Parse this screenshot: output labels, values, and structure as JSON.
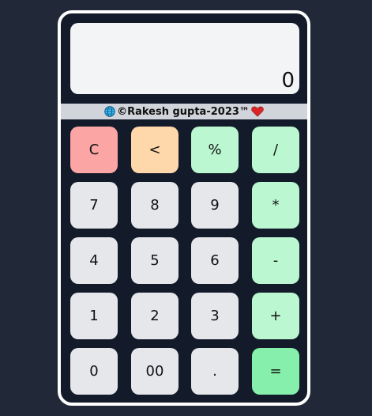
{
  "display": {
    "value": "0"
  },
  "credit": {
    "text": "©Rakesh gupta-2023™",
    "leading_icon": "globe-icon",
    "trailing_icon": "heart-icon"
  },
  "colors": {
    "page_background": "#212938",
    "calculator_body": "#131a29",
    "display_background": "#f3f4f6",
    "credit_bar": "#d1d5db",
    "clear_key": "#fca5a5",
    "backspace_key": "#fed7aa",
    "operator_key": "#bbf7d0",
    "equals_key": "#86efac",
    "number_key": "#e5e7eb",
    "heart": "#dc2626"
  },
  "keys": [
    {
      "label": "C",
      "name": "clear-button",
      "type": "clear"
    },
    {
      "label": "<",
      "name": "backspace-button",
      "type": "backspace"
    },
    {
      "label": "%",
      "name": "percent-button",
      "type": "operator"
    },
    {
      "label": "/",
      "name": "divide-button",
      "type": "operator"
    },
    {
      "label": "7",
      "name": "digit-7-button",
      "type": "number"
    },
    {
      "label": "8",
      "name": "digit-8-button",
      "type": "number"
    },
    {
      "label": "9",
      "name": "digit-9-button",
      "type": "number"
    },
    {
      "label": "*",
      "name": "multiply-button",
      "type": "operator"
    },
    {
      "label": "4",
      "name": "digit-4-button",
      "type": "number"
    },
    {
      "label": "5",
      "name": "digit-5-button",
      "type": "number"
    },
    {
      "label": "6",
      "name": "digit-6-button",
      "type": "number"
    },
    {
      "label": "-",
      "name": "subtract-button",
      "type": "operator"
    },
    {
      "label": "1",
      "name": "digit-1-button",
      "type": "number"
    },
    {
      "label": "2",
      "name": "digit-2-button",
      "type": "number"
    },
    {
      "label": "3",
      "name": "digit-3-button",
      "type": "number"
    },
    {
      "label": "+",
      "name": "add-button",
      "type": "operator"
    },
    {
      "label": "0",
      "name": "digit-0-button",
      "type": "number"
    },
    {
      "label": "00",
      "name": "double-zero-button",
      "type": "number"
    },
    {
      "label": ".",
      "name": "decimal-button",
      "type": "number"
    },
    {
      "label": "=",
      "name": "equals-button",
      "type": "equals"
    }
  ]
}
